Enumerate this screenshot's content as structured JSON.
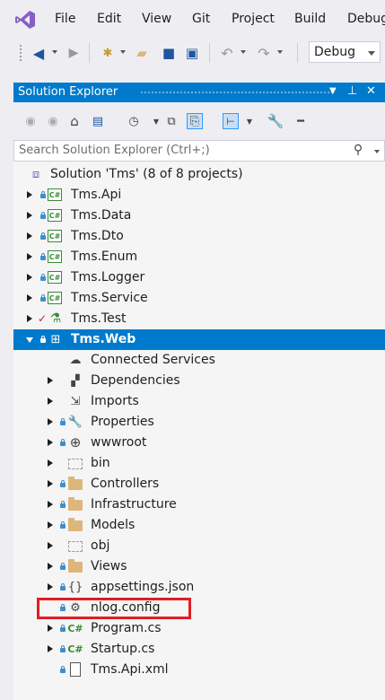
{
  "menu": {
    "items": [
      {
        "label": "File"
      },
      {
        "label": "Edit"
      },
      {
        "label": "View"
      },
      {
        "label": "Git"
      },
      {
        "label": "Project"
      },
      {
        "label": "Build"
      },
      {
        "label": "Debug"
      }
    ]
  },
  "toolbar": {
    "configuration": "Debug"
  },
  "solution_explorer": {
    "title": "Solution Explorer",
    "search_placeholder": "Search Solution Explorer (Ctrl+;)",
    "tree": [
      {
        "label": "Solution 'Tms' (8 of 8 projects)",
        "icon": "solution-icon"
      },
      {
        "label": "Tms.Api",
        "icon": "csharp-project-icon"
      },
      {
        "label": "Tms.Data",
        "icon": "csharp-project-icon"
      },
      {
        "label": "Tms.Dto",
        "icon": "csharp-project-icon"
      },
      {
        "label": "Tms.Enum",
        "icon": "csharp-project-icon"
      },
      {
        "label": "Tms.Logger",
        "icon": "csharp-project-icon"
      },
      {
        "label": "Tms.Service",
        "icon": "csharp-project-icon"
      },
      {
        "label": "Tms.Test",
        "icon": "test-project-icon"
      },
      {
        "label": "Tms.Web",
        "icon": "web-project-icon"
      },
      {
        "label": "Connected Services",
        "icon": "connected-services-icon"
      },
      {
        "label": "Dependencies",
        "icon": "dependencies-icon"
      },
      {
        "label": "Imports",
        "icon": "imports-icon"
      },
      {
        "label": "Properties",
        "icon": "properties-icon"
      },
      {
        "label": "wwwroot",
        "icon": "globe-icon"
      },
      {
        "label": "bin",
        "icon": "folder-icon"
      },
      {
        "label": "Controllers",
        "icon": "folder-icon"
      },
      {
        "label": "Infrastructure",
        "icon": "folder-icon"
      },
      {
        "label": "Models",
        "icon": "folder-icon"
      },
      {
        "label": "obj",
        "icon": "folder-icon"
      },
      {
        "label": "Views",
        "icon": "folder-icon"
      },
      {
        "label": "appsettings.json",
        "icon": "json-file-icon"
      },
      {
        "label": "nlog.config",
        "icon": "config-file-icon"
      },
      {
        "label": "Program.cs",
        "icon": "csharp-file-icon"
      },
      {
        "label": "Startup.cs",
        "icon": "csharp-file-icon"
      },
      {
        "label": "Tms.Api.xml",
        "icon": "xml-file-icon"
      }
    ]
  },
  "colors": {
    "accent": "#007acc",
    "highlight_border": "#e31c23"
  }
}
